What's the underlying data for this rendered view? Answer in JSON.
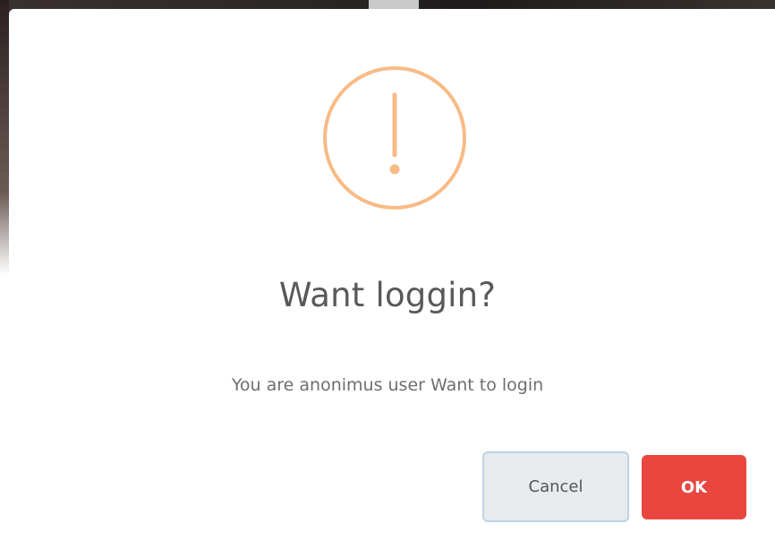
{
  "dialog": {
    "title": "Want loggin?",
    "message": "You are anonimus user Want to login",
    "icon": "warning-exclamation-icon",
    "icon_color": "#f8bb86",
    "buttons": {
      "cancel_label": "Cancel",
      "ok_label": "OK"
    },
    "colors": {
      "ok_background": "#e8463f",
      "cancel_background": "#e8ebed",
      "cancel_border": "#bcd3e6"
    }
  }
}
